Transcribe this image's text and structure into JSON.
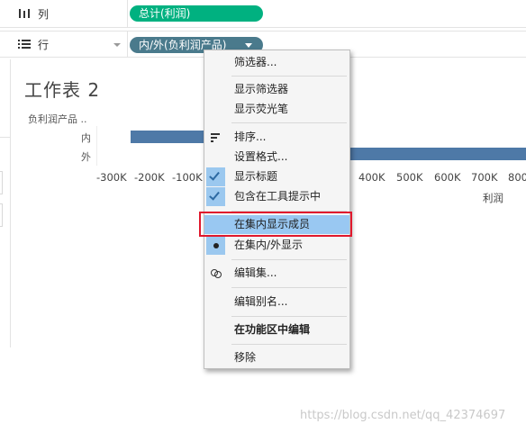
{
  "columns_shelf": {
    "label": "列",
    "pill": "总计(利润)",
    "pill_color": "#00b180"
  },
  "rows_shelf": {
    "label": "行",
    "pill": "内/外(负利润产品)",
    "pill_color": "#4a7a8c"
  },
  "worksheet": {
    "title": "工作表 2",
    "row_header": "负利润产品 ..",
    "rows": [
      "内",
      "外"
    ],
    "bar_color": "#4e79a7",
    "axis_ticks": [
      "-300K",
      "-200K",
      "-100K",
      "400K",
      "500K",
      "600K",
      "700K",
      "800"
    ],
    "axis_title": "利润"
  },
  "context_menu": {
    "items": {
      "filter": "筛选器...",
      "show_filter": "显示筛选器",
      "show_highlighter": "显示荧光笔",
      "sort": "排序...",
      "format": "设置格式...",
      "show_header": "显示标题",
      "include_tooltip": "包含在工具提示中",
      "show_members_in_set": "在集内显示成员",
      "show_in_out_set": "在集内/外显示",
      "edit_set": "编辑集...",
      "edit_alias": "编辑别名...",
      "edit_in_shelf": "在功能区中编辑",
      "remove": "移除"
    },
    "highlight_color": "#99c8f2"
  },
  "highlight_box_color": "#e0182d",
  "watermark": "https://blog.csdn.net/qq_42374697"
}
